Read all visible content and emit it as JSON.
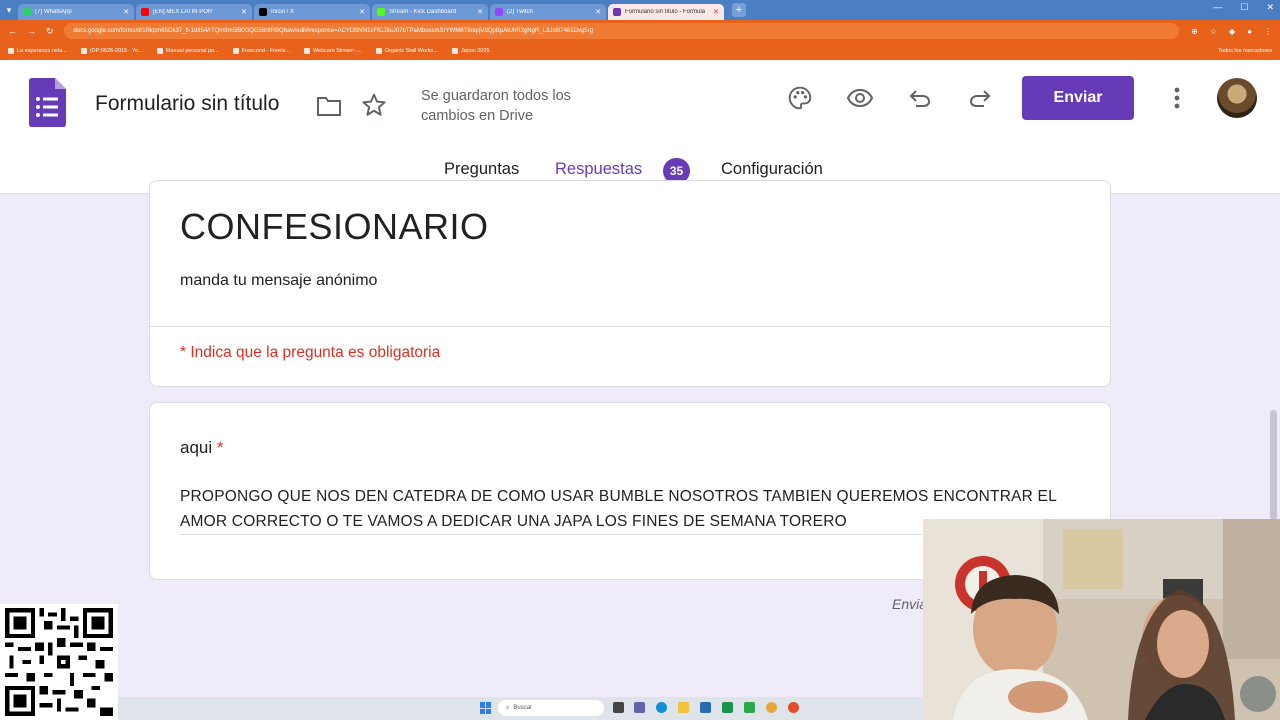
{
  "browser": {
    "tabs": [
      {
        "label": "(7) WhatsApp",
        "color": "#25d366"
      },
      {
        "label": "[EN] MEX LATIN POR",
        "color": "#ff0000"
      },
      {
        "label": "Inicio / X",
        "color": "#000000"
      },
      {
        "label": "Stream - Kick Dashboard",
        "color": "#53fc18"
      },
      {
        "label": "(2) Twitch",
        "color": "#9146ff"
      },
      {
        "label": "Formulario sin título - Formula",
        "color": "#673ab7"
      }
    ],
    "url": "docs.google.com/forms/d/1Rkpm65Ok37_fi-19854/rTQm8m5lB0GQG56r9RBQ6aw/edit#response=ACYDBNhl1sFfCJ3uJ07bTPaMbossmSrYWM8T8nqrjVdQpBpAlUhR3gNgR_L3Jx8t7461Dvg5rg",
    "bookmarks": [
      "La esperanza nela...",
      "(DP:9626-2015 - Yo...",
      "Manual personal pa...",
      "Freecond - Freets...",
      "Webcam Stream -...",
      "Organiz Stall Works...",
      "Japon 2025"
    ],
    "bookmarks_all": "Todos los marcadores"
  },
  "header": {
    "form_title": "Formulario sin título",
    "save_status": "Se guardaron todos los cambios en Drive",
    "send_label": "Enviar"
  },
  "form_tabs": {
    "questions": "Preguntas",
    "responses": "Respuestas",
    "responses_count": "35",
    "settings": "Configuración"
  },
  "form": {
    "heading": "CONFESIONARIO",
    "description": "manda tu mensaje anónimo",
    "required_note": "* Indica que la pregunta es obligatoria"
  },
  "question": {
    "title": "aqui",
    "required_mark": "*",
    "answer": "PROPONGO QUE NOS DEN CATEDRA DE COMO USAR BUMBLE NOSOTROS TAMBIEN QUEREMOS ENCONTRAR EL AMOR CORRECTO O TE VAMOS  A DEDICAR UNA JAPA LOS FINES DE SEMANA TORERO"
  },
  "footer": {
    "sent_partial": "Envia"
  },
  "taskbar": {
    "search_placeholder": "Buscar"
  },
  "colors": {
    "accent": "#673ab7",
    "background": "#f0ebf8",
    "required": "#d93025"
  }
}
